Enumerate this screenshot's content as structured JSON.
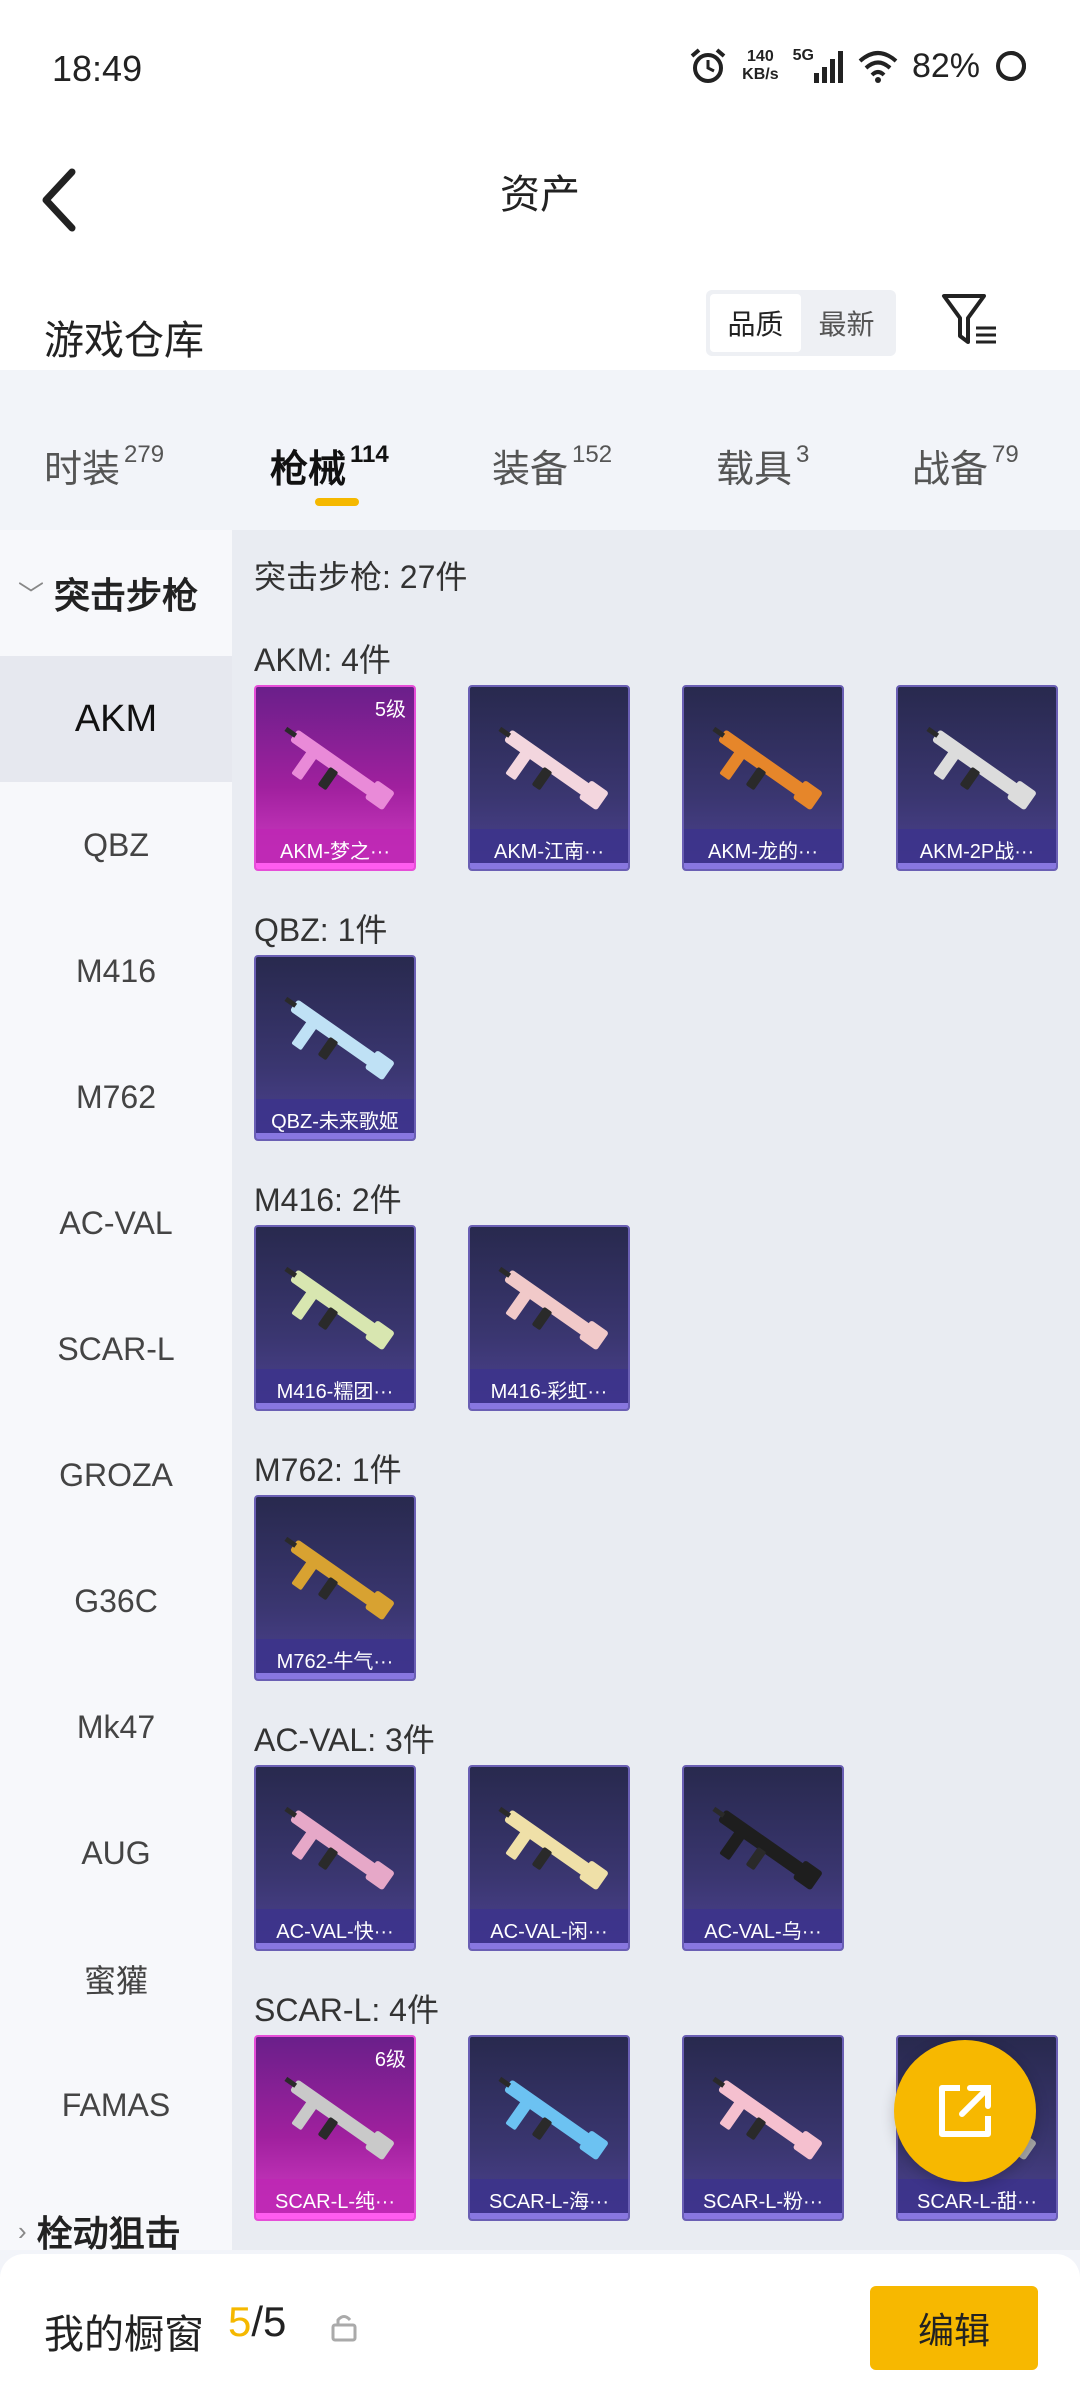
{
  "status_bar": {
    "time": "18:49",
    "net_speed_value": "140",
    "net_speed_unit": "KB/s",
    "network": "5G",
    "battery": "82%",
    "icons": [
      "alarm-icon",
      "signal-icon",
      "wifi-icon",
      "battery-icon"
    ]
  },
  "header": {
    "title": "资产",
    "warehouse_title": "游戏仓库",
    "sort": {
      "options": [
        "品质",
        "最新"
      ],
      "selected": "品质"
    }
  },
  "tabs": [
    {
      "label": "时装",
      "count": "279"
    },
    {
      "label": "枪械",
      "count": "114",
      "active": true
    },
    {
      "label": "装备",
      "count": "152"
    },
    {
      "label": "载具",
      "count": "3"
    },
    {
      "label": "战备",
      "count": "79"
    }
  ],
  "sidebar": {
    "group_expanded": "突击步枪",
    "items": [
      "AKM",
      "QBZ",
      "M416",
      "M762",
      "AC-VAL",
      "SCAR-L",
      "GROZA",
      "G36C",
      "Mk47",
      "AUG",
      "蜜獾",
      "FAMAS"
    ],
    "active": "AKM",
    "group_collapsed": "栓动狙击"
  },
  "content": {
    "section_title": "突击步枪: 27件",
    "groups": [
      {
        "title": "AKM: 4件",
        "items": [
          {
            "name": "AKM-梦之···",
            "level": "5级",
            "rarity": "pink"
          },
          {
            "name": "AKM-江南···",
            "rarity": "purple"
          },
          {
            "name": "AKM-龙的···",
            "rarity": "purple"
          },
          {
            "name": "AKM-2P战···",
            "rarity": "purple"
          }
        ]
      },
      {
        "title": "QBZ: 1件",
        "items": [
          {
            "name": "QBZ-未来歌姬",
            "rarity": "purple"
          }
        ]
      },
      {
        "title": "M416: 2件",
        "items": [
          {
            "name": "M416-糯团···",
            "rarity": "purple"
          },
          {
            "name": "M416-彩虹···",
            "rarity": "purple"
          }
        ]
      },
      {
        "title": "M762: 1件",
        "items": [
          {
            "name": "M762-牛气···",
            "rarity": "purple"
          }
        ]
      },
      {
        "title": "AC-VAL: 3件",
        "items": [
          {
            "name": "AC-VAL-快···",
            "rarity": "purple"
          },
          {
            "name": "AC-VAL-闲···",
            "rarity": "purple"
          },
          {
            "name": "AC-VAL-乌···",
            "rarity": "purple"
          }
        ]
      },
      {
        "title": "SCAR-L: 4件",
        "items": [
          {
            "name": "SCAR-L-纯···",
            "level": "6级",
            "rarity": "pink"
          },
          {
            "name": "SCAR-L-海···",
            "rarity": "purple"
          },
          {
            "name": "SCAR-L-粉···",
            "rarity": "purple"
          },
          {
            "name": "SCAR-L-甜···",
            "rarity": "purple"
          }
        ]
      }
    ]
  },
  "bottom_bar": {
    "title": "我的橱窗",
    "count_current": "5",
    "count_sep": "/",
    "count_total": "5",
    "edit_label": "编辑"
  },
  "colors": {
    "accent": "#f7b800",
    "card_purple": "#3a3670",
    "card_pink": "#a0209e"
  }
}
